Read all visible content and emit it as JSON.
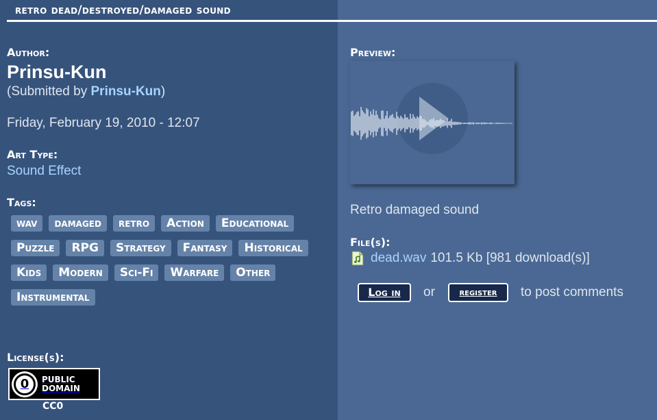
{
  "title": "retro dead/destroyed/damaged sound",
  "author": {
    "label": "Author:",
    "name": "Prinsu-Kun",
    "submitted_prefix": "(Submitted by ",
    "submitted_by": "Prinsu-Kun",
    "submitted_suffix": ")"
  },
  "date": "Friday, February 19, 2010 - 12:07",
  "art_type": {
    "label": "Art Type:",
    "value": "Sound Effect"
  },
  "tags": {
    "label": "Tags:",
    "items": [
      "wav",
      "damaged",
      "retro",
      "Action",
      "Educational",
      "Puzzle",
      "RPG",
      "Strategy",
      "Fantasy",
      "Historical",
      "Kids",
      "Modern",
      "Sci-Fi",
      "Warfare",
      "Other",
      "Instrumental"
    ]
  },
  "license": {
    "label": "License(s):",
    "badge_line1": "PUBLIC",
    "badge_line2": "DOMAIN",
    "badge_symbol": "0",
    "code": "CC0"
  },
  "preview": {
    "label": "Preview:",
    "icon": "play-icon"
  },
  "description": "Retro damaged sound",
  "files": {
    "label": "File(s):",
    "icon": "audio-file-icon",
    "name": "dead.wav",
    "info": "101.5 Kb [981 download(s)]"
  },
  "comments": {
    "login_label": "Log in",
    "or_text": "or",
    "register_label": "register",
    "suffix": "to post comments"
  },
  "colors": {
    "left_bg": "#36537c",
    "right_bg": "#4a6893",
    "link": "#a8d4ff",
    "tag_bg": "#6583a9",
    "button_bg": "#17284a"
  }
}
